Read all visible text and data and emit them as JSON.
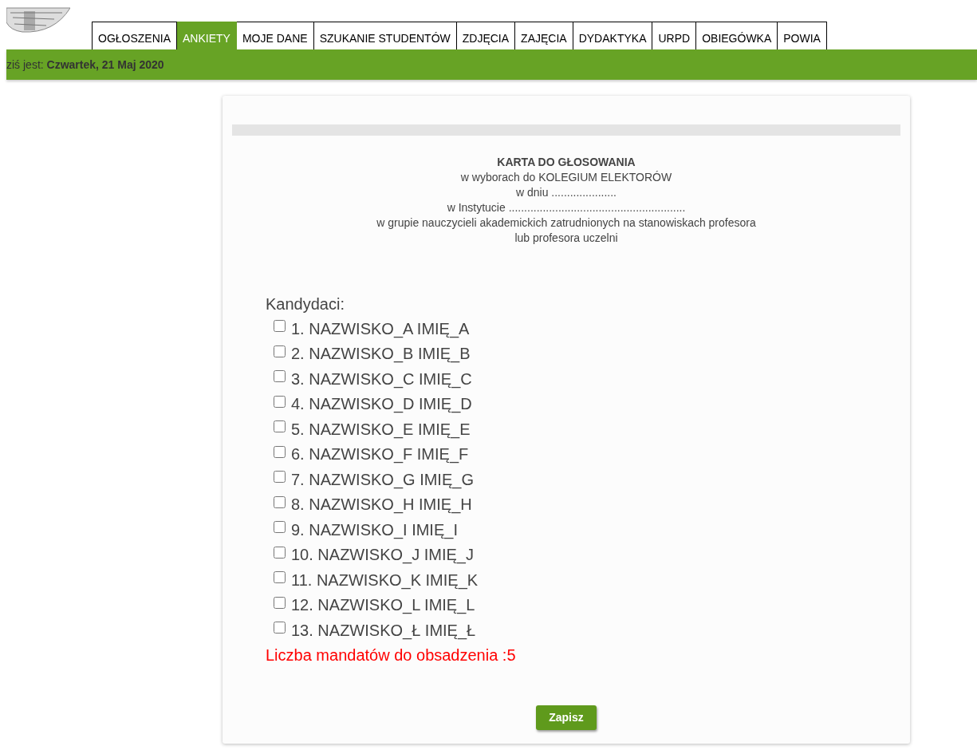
{
  "tabs": [
    {
      "label": "OGŁOSZENIA",
      "selected": false
    },
    {
      "label": "ANKIETY",
      "selected": true
    },
    {
      "label": "MOJE DANE",
      "selected": false
    },
    {
      "label": "SZUKANIE STUDENTÓW",
      "selected": false
    },
    {
      "label": "ZDJĘCIA",
      "selected": false
    },
    {
      "label": "ZAJĘCIA",
      "selected": false
    },
    {
      "label": "DYDAKTYKA",
      "selected": false
    },
    {
      "label": "URPD",
      "selected": false
    },
    {
      "label": "OBIEGÓWKA",
      "selected": false
    },
    {
      "label": "POWIA",
      "selected": false
    }
  ],
  "date_bar": "ziś jest: **Czwartek, 21 Maj 2020**",
  "ballot": {
    "title": "KARTA DO GŁOSOWANIA",
    "lines": [
      "w wyborach do KOLEGIUM ELEKTORÓW",
      "w dniu .....................",
      "w Instytucie .........................................................",
      "w grupie nauczycieli akademickich zatrudnionych na stanowiskach profesora",
      "lub profesora uczelni"
    ],
    "candidates_label": "Kandydaci:",
    "candidates": [
      {
        "label": "1. NAZWISKO_A IMIĘ_A",
        "checked": false
      },
      {
        "label": "2. NAZWISKO_B IMIĘ_B",
        "checked": false
      },
      {
        "label": "3. NAZWISKO_C IMIĘ_C",
        "checked": false
      },
      {
        "label": "4. NAZWISKO_D IMIĘ_D",
        "checked": false
      },
      {
        "label": "5. NAZWISKO_E IMIĘ_E",
        "checked": false
      },
      {
        "label": "6. NAZWISKO_F IMIĘ_F",
        "checked": false
      },
      {
        "label": "7. NAZWISKO_G IMIĘ_G",
        "checked": false
      },
      {
        "label": "8. NAZWISKO_H IMIĘ_H",
        "checked": false
      },
      {
        "label": "9. NAZWISKO_I IMIĘ_I",
        "checked": false
      },
      {
        "label": "10. NAZWISKO_J IMIĘ_J",
        "checked": false
      },
      {
        "label": "11. NAZWISKO_K IMIĘ_K",
        "checked": false
      },
      {
        "label": "12. NAZWISKO_L IMIĘ_L",
        "checked": false
      },
      {
        "label": "13. NAZWISKO_Ł IMIĘ_Ł",
        "checked": false
      }
    ],
    "seats_note": "Liczba mandatów do obsadzenia :5",
    "submit": "Zapisz"
  }
}
